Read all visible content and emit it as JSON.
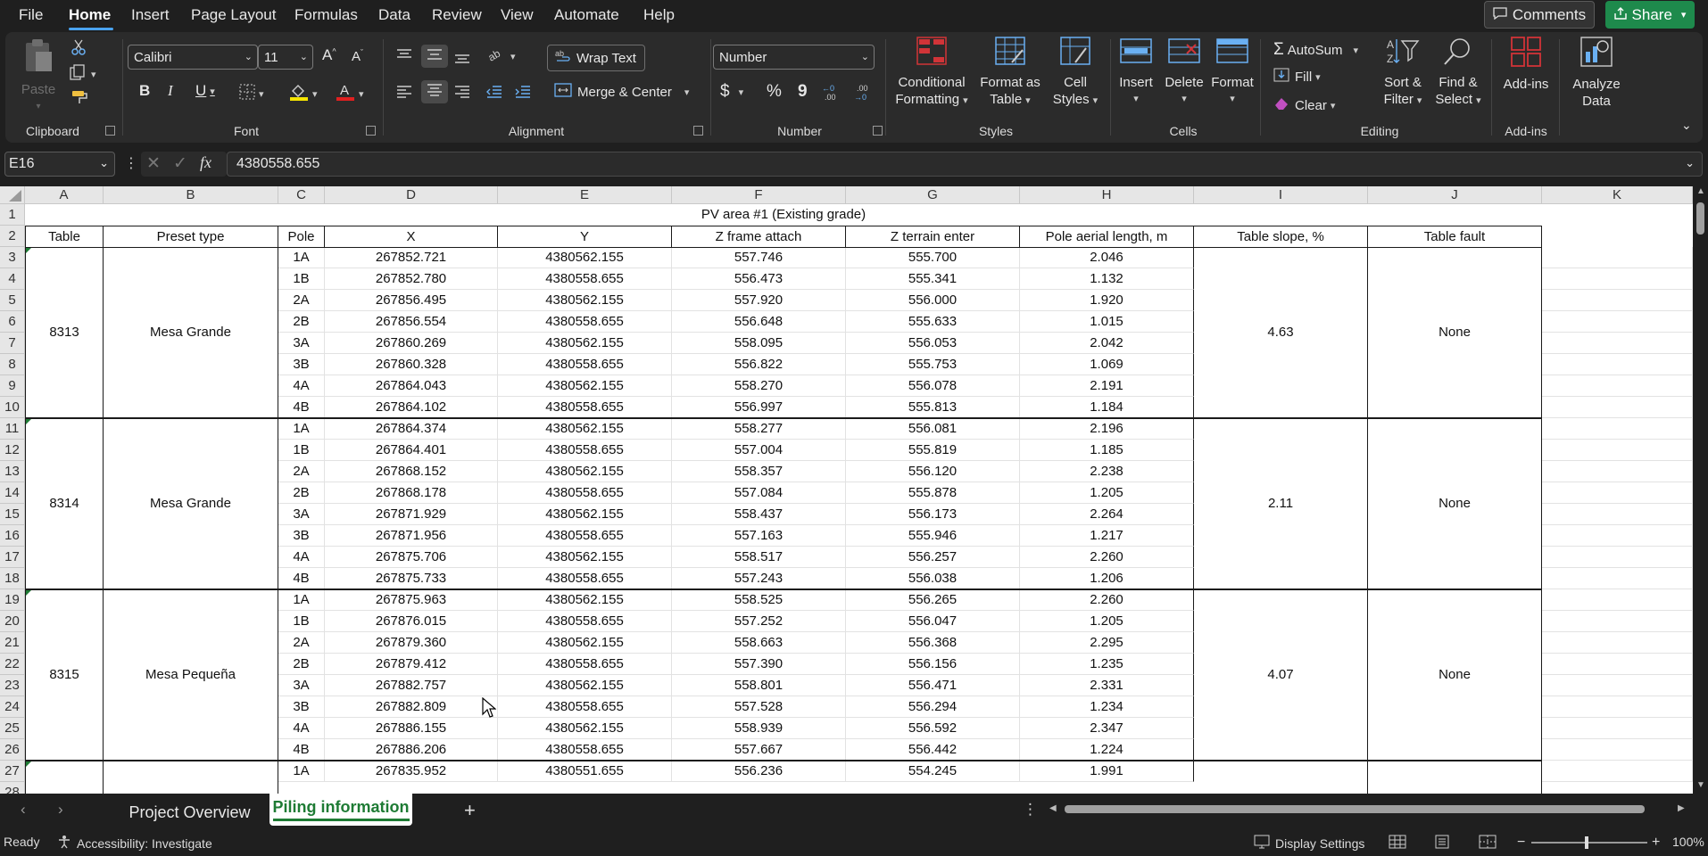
{
  "menu": {
    "items": [
      "File",
      "Home",
      "Insert",
      "Page Layout",
      "Formulas",
      "Data",
      "Review",
      "View",
      "Automate",
      "Help"
    ],
    "active": "Home",
    "comments_label": "Comments",
    "share_label": "Share"
  },
  "ribbon": {
    "clipboard": {
      "label": "Clipboard",
      "paste": "Paste"
    },
    "font": {
      "label": "Font",
      "font_name": "Calibri",
      "font_size": "11",
      "bold": "B",
      "italic": "I",
      "underline": "U"
    },
    "alignment": {
      "label": "Alignment",
      "wrap_text": "Wrap Text",
      "merge_center": "Merge & Center"
    },
    "number": {
      "label": "Number",
      "format": "Number",
      "currency": "$",
      "percent": "%",
      "comma": "9"
    },
    "styles": {
      "label": "Styles",
      "conditional_formatting": [
        "Conditional",
        "Formatting"
      ],
      "format_as_table": [
        "Format as",
        "Table"
      ],
      "cell_styles": [
        "Cell",
        "Styles"
      ]
    },
    "cells": {
      "label": "Cells",
      "insert": "Insert",
      "delete": "Delete",
      "format": "Format"
    },
    "editing": {
      "label": "Editing",
      "autosum": "AutoSum",
      "fill": "Fill",
      "clear": "Clear",
      "sort_filter": [
        "Sort &",
        "Filter"
      ],
      "find_select": [
        "Find &",
        "Select"
      ]
    },
    "addins": {
      "label": "Add-ins",
      "addins": "Add-ins",
      "analyze": [
        "Analyze",
        "Data"
      ]
    }
  },
  "formula_bar": {
    "name_box": "E16",
    "fx": "fx",
    "value": "4380558.655"
  },
  "columns": [
    "A",
    "B",
    "C",
    "D",
    "E",
    "F",
    "G",
    "H",
    "I",
    "J",
    "K"
  ],
  "sheet": {
    "title": "PV area #1 (Existing grade)",
    "headers": [
      "Table",
      "Preset type",
      "Pole",
      "X",
      "Y",
      "Z frame attach",
      "Z terrain enter",
      "Pole aerial length, m",
      "Table slope, %",
      "Table fault"
    ],
    "groups": [
      {
        "table": "8313",
        "preset": "Mesa Grande",
        "slope": "4.63",
        "fault": "None",
        "rows": [
          [
            "1A",
            "267852.721",
            "4380562.155",
            "557.746",
            "555.700",
            "2.046"
          ],
          [
            "1B",
            "267852.780",
            "4380558.655",
            "556.473",
            "555.341",
            "1.132"
          ],
          [
            "2A",
            "267856.495",
            "4380562.155",
            "557.920",
            "556.000",
            "1.920"
          ],
          [
            "2B",
            "267856.554",
            "4380558.655",
            "556.648",
            "555.633",
            "1.015"
          ],
          [
            "3A",
            "267860.269",
            "4380562.155",
            "558.095",
            "556.053",
            "2.042"
          ],
          [
            "3B",
            "267860.328",
            "4380558.655",
            "556.822",
            "555.753",
            "1.069"
          ],
          [
            "4A",
            "267864.043",
            "4380562.155",
            "558.270",
            "556.078",
            "2.191"
          ],
          [
            "4B",
            "267864.102",
            "4380558.655",
            "556.997",
            "555.813",
            "1.184"
          ]
        ]
      },
      {
        "table": "8314",
        "preset": "Mesa Grande",
        "slope": "2.11",
        "fault": "None",
        "rows": [
          [
            "1A",
            "267864.374",
            "4380562.155",
            "558.277",
            "556.081",
            "2.196"
          ],
          [
            "1B",
            "267864.401",
            "4380558.655",
            "557.004",
            "555.819",
            "1.185"
          ],
          [
            "2A",
            "267868.152",
            "4380562.155",
            "558.357",
            "556.120",
            "2.238"
          ],
          [
            "2B",
            "267868.178",
            "4380558.655",
            "557.084",
            "555.878",
            "1.205"
          ],
          [
            "3A",
            "267871.929",
            "4380562.155",
            "558.437",
            "556.173",
            "2.264"
          ],
          [
            "3B",
            "267871.956",
            "4380558.655",
            "557.163",
            "555.946",
            "1.217"
          ],
          [
            "4A",
            "267875.706",
            "4380562.155",
            "558.517",
            "556.257",
            "2.260"
          ],
          [
            "4B",
            "267875.733",
            "4380558.655",
            "557.243",
            "556.038",
            "1.206"
          ]
        ]
      },
      {
        "table": "8315",
        "preset": "Mesa Pequeña",
        "slope": "4.07",
        "fault": "None",
        "rows": [
          [
            "1A",
            "267875.963",
            "4380562.155",
            "558.525",
            "556.265",
            "2.260"
          ],
          [
            "1B",
            "267876.015",
            "4380558.655",
            "557.252",
            "556.047",
            "1.205"
          ],
          [
            "2A",
            "267879.360",
            "4380562.155",
            "558.663",
            "556.368",
            "2.295"
          ],
          [
            "2B",
            "267879.412",
            "4380558.655",
            "557.390",
            "556.156",
            "1.235"
          ],
          [
            "3A",
            "267882.757",
            "4380562.155",
            "558.801",
            "556.471",
            "2.331"
          ],
          [
            "3B",
            "267882.809",
            "4380558.655",
            "557.528",
            "556.294",
            "1.234"
          ],
          [
            "4A",
            "267886.155",
            "4380562.155",
            "558.939",
            "556.592",
            "2.347"
          ],
          [
            "4B",
            "267886.206",
            "4380558.655",
            "557.667",
            "556.442",
            "1.224"
          ]
        ]
      },
      {
        "table": "",
        "preset": "",
        "slope": "",
        "fault": "",
        "rows": [
          [
            "1A",
            "267835.952",
            "4380551.655",
            "556.236",
            "554.245",
            "1.991"
          ]
        ]
      }
    ]
  },
  "tabs": {
    "items": [
      "Project Overview",
      "Piling information"
    ],
    "active": "Piling information",
    "add": "+"
  },
  "status": {
    "ready": "Ready",
    "accessibility": "Accessibility: Investigate",
    "display_settings": "Display Settings",
    "zoom": "100%"
  },
  "colors": {
    "accent_green": "#1e7b34",
    "share_green": "#1e8a4c",
    "tab_underline": "#4aa3f0",
    "autosum_red": "#d13438"
  }
}
